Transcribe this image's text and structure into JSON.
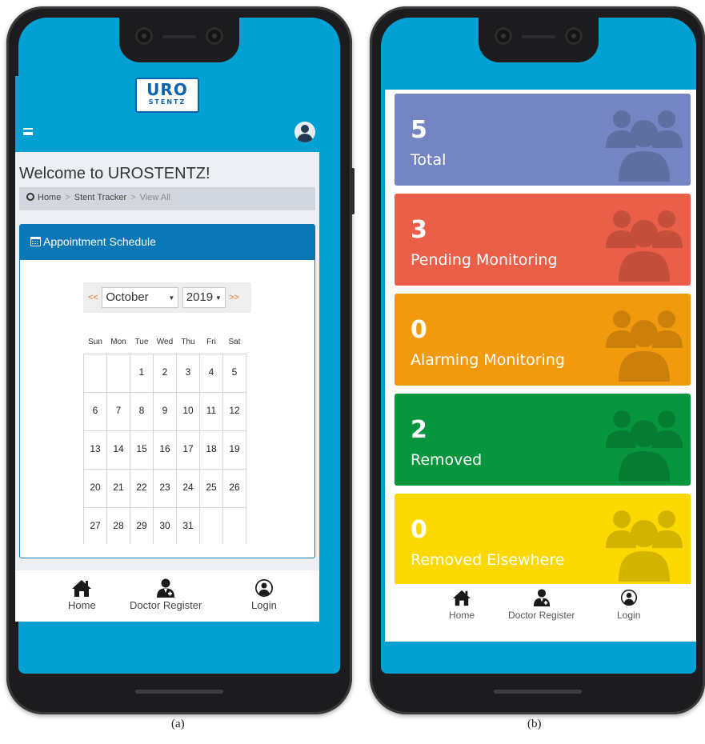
{
  "left_screen": {
    "logo": {
      "line1": "URO",
      "line2": "STENTZ"
    },
    "welcome_title": "Welcome to UROSTENTZ!",
    "breadcrumb": {
      "home": "Home",
      "sep1": ">",
      "section": "Stent Tracker",
      "sep2": ">",
      "current": "View All"
    },
    "card_title": "Appointment Schedule",
    "calendar": {
      "prev": "<<",
      "next": ">>",
      "month": "October",
      "year": "2019",
      "caret": "▼",
      "weekdays": [
        "Sun",
        "Mon",
        "Tue",
        "Wed",
        "Thu",
        "Fri",
        "Sat"
      ],
      "weeks": [
        [
          "",
          "",
          "1",
          "2",
          "3",
          "4",
          "5"
        ],
        [
          "6",
          "7",
          "8",
          "9",
          "10",
          "11",
          "12"
        ],
        [
          "13",
          "14",
          "15",
          "16",
          "17",
          "18",
          "19"
        ],
        [
          "20",
          "21",
          "22",
          "23",
          "24",
          "25",
          "26"
        ],
        [
          "27",
          "28",
          "29",
          "30",
          "31",
          "",
          ""
        ]
      ]
    },
    "footer_nav": [
      {
        "label": "Home",
        "icon": "home-icon"
      },
      {
        "label": "Doctor Register",
        "icon": "doctor-icon"
      },
      {
        "label": "Login",
        "icon": "user-circle-icon"
      }
    ]
  },
  "right_screen": {
    "tiles": [
      {
        "value": "5",
        "label": "Total",
        "color": "#7584c2"
      },
      {
        "value": "3",
        "label": "Pending Monitoring",
        "color": "#eb5f48"
      },
      {
        "value": "0",
        "label": "Alarming Monitoring",
        "color": "#f29a0e"
      },
      {
        "value": "2",
        "label": "Removed",
        "color": "#07963d"
      },
      {
        "value": "0",
        "label": "Removed Elsewhere",
        "color": "#fad800"
      }
    ],
    "footer_nav": [
      {
        "label": "Home",
        "icon": "home-icon"
      },
      {
        "label": "Doctor Register",
        "icon": "doctor-icon"
      },
      {
        "label": "Login",
        "icon": "user-circle-icon"
      }
    ]
  },
  "captions": {
    "a": "(a)",
    "b": "(b)"
  },
  "colors": {
    "app_blue": "#03a0d4",
    "card_blue": "#0b78b5",
    "accent_orange": "#f08020"
  }
}
